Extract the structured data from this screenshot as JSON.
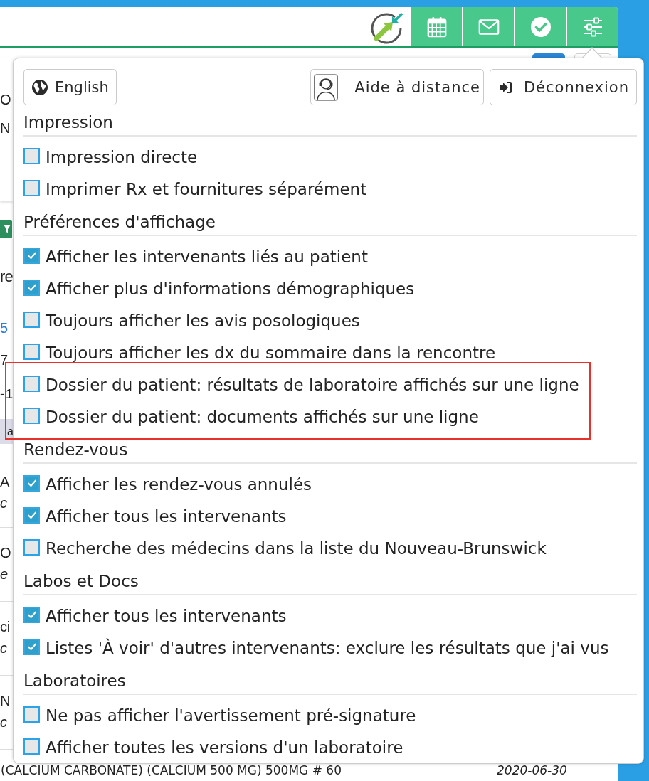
{
  "background": {
    "banner_lines": [
      "O",
      "N"
    ],
    "summary": [
      {
        "kind": "heading",
        "text": "re"
      },
      {
        "kind": "link",
        "text": "5"
      },
      {
        "kind": "text",
        "text": "7"
      },
      {
        "kind": "text",
        "text": "-1"
      }
    ],
    "table_header": "a",
    "medications": [
      {
        "name": "A",
        "detail": "c"
      },
      {
        "name": "O",
        "detail": "e"
      },
      {
        "name": "ci",
        "detail": "c"
      },
      {
        "name": "N",
        "detail": "c"
      },
      {
        "name": "(CALCIUM CARBONATE) (CALCIUM 500 MG) 500MG # 60",
        "date": "2020-06-30"
      }
    ]
  },
  "settings_menu": {
    "buttons": [
      {
        "kind": "language",
        "label": "English"
      },
      {
        "kind": "remote_help",
        "label": "Aide à distance"
      },
      {
        "kind": "logout",
        "label": "Déconnexion"
      }
    ],
    "sections": [
      {
        "title": "Impression",
        "options": [
          {
            "label": "Impression directe",
            "checked": false,
            "highlighted": false
          },
          {
            "label": "Imprimer Rx et fournitures séparément",
            "checked": false,
            "highlighted": false
          }
        ]
      },
      {
        "title": "Préférences d'affichage",
        "options": [
          {
            "label": "Afficher les intervenants liés au patient",
            "checked": true,
            "highlighted": false
          },
          {
            "label": "Afficher plus d'informations démographiques",
            "checked": true,
            "highlighted": false
          },
          {
            "label": "Toujours afficher les avis posologiques",
            "checked": false,
            "highlighted": false
          },
          {
            "label": "Toujours afficher les dx du sommaire dans la rencontre",
            "checked": false,
            "highlighted": false
          },
          {
            "label": "Dossier du patient: résultats de laboratoire affichés sur une ligne",
            "checked": false,
            "highlighted": true
          },
          {
            "label": "Dossier du patient: documents affichés sur une ligne",
            "checked": false,
            "highlighted": true
          }
        ]
      },
      {
        "title": "Rendez-vous",
        "options": [
          {
            "label": "Afficher les rendez-vous annulés",
            "checked": true,
            "highlighted": false
          },
          {
            "label": "Afficher tous les intervenants",
            "checked": true,
            "highlighted": false
          },
          {
            "label": "Recherche des médecins dans la liste du Nouveau-Brunswick",
            "checked": false,
            "highlighted": false
          }
        ]
      },
      {
        "title": "Labos et Docs",
        "options": [
          {
            "label": "Afficher tous les intervenants",
            "checked": true,
            "highlighted": false
          },
          {
            "label": "Listes 'À voir' d'autres intervenants: exclure les résultats que j'ai vus",
            "checked": true,
            "highlighted": false
          }
        ]
      },
      {
        "title": "Laboratoires",
        "options": [
          {
            "label": "Ne pas afficher l'avertissement pré-signature",
            "checked": false,
            "highlighted": false
          },
          {
            "label": "Afficher toutes les versions d'un laboratoire",
            "checked": false,
            "highlighted": false
          }
        ]
      }
    ]
  }
}
